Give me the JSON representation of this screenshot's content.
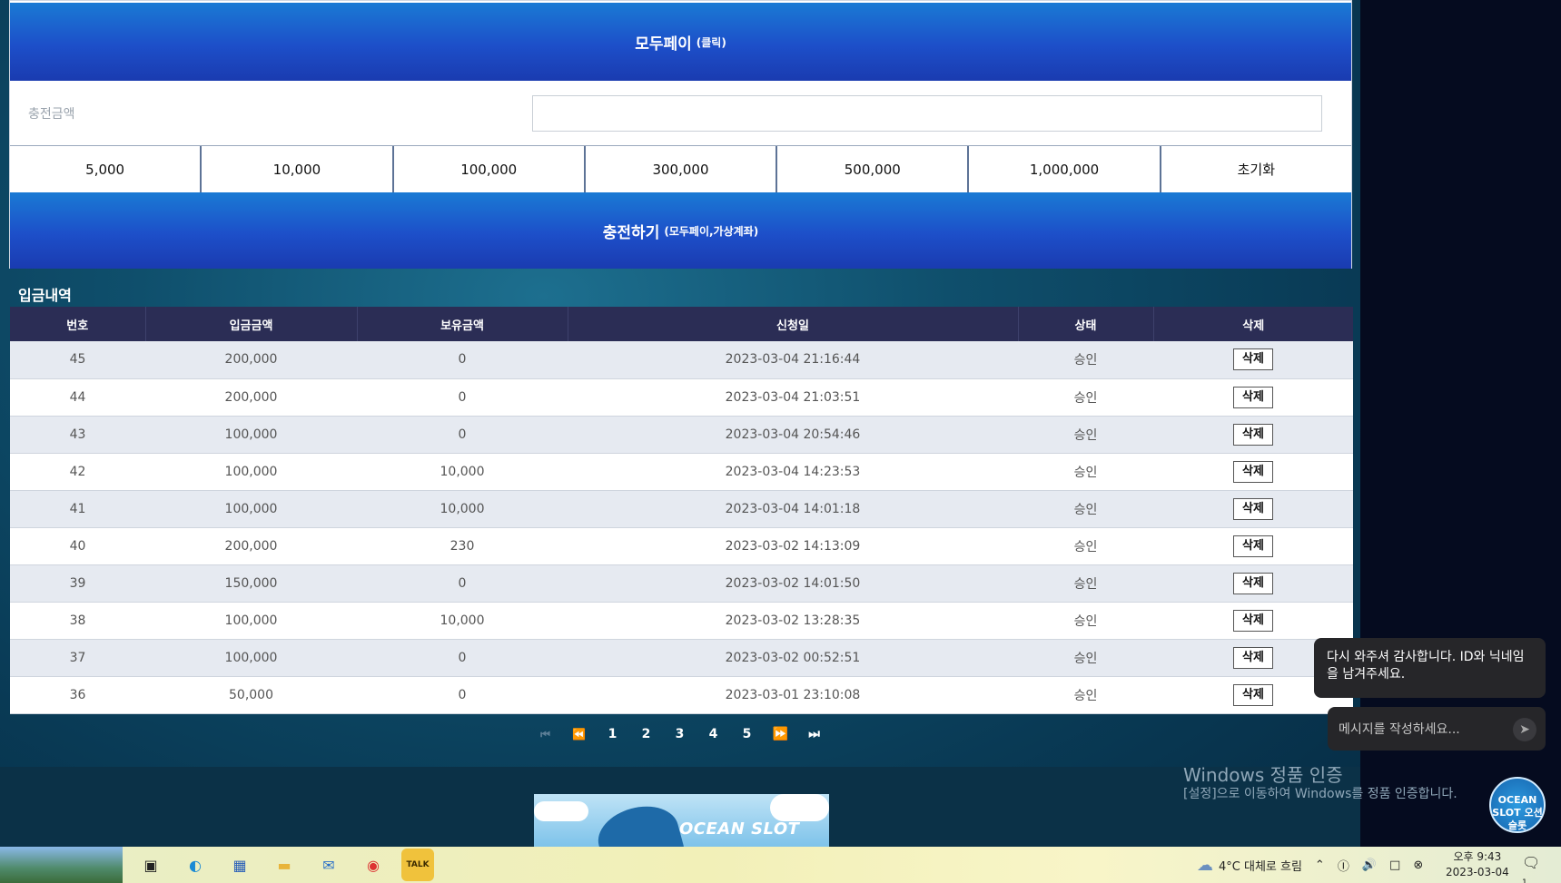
{
  "payment": {
    "title": "모두페이",
    "title_note": "(클릭)",
    "amount_label": "충전금액",
    "amount_value": "",
    "quick_amounts": [
      "5,000",
      "10,000",
      "100,000",
      "300,000",
      "500,000",
      "1,000,000",
      "초기화"
    ],
    "submit_label": "충전하기",
    "submit_note": "(모두페이,가상계좌)"
  },
  "history": {
    "title": "입금내역",
    "columns": [
      "번호",
      "입금금액",
      "보유금액",
      "신청일",
      "상태",
      "삭제"
    ],
    "rows": [
      [
        "45",
        "200,000",
        "0",
        "2023-03-04 21:16:44",
        "승인",
        "삭제"
      ],
      [
        "44",
        "200,000",
        "0",
        "2023-03-04 21:03:51",
        "승인",
        "삭제"
      ],
      [
        "43",
        "100,000",
        "0",
        "2023-03-04 20:54:46",
        "승인",
        "삭제"
      ],
      [
        "42",
        "100,000",
        "10,000",
        "2023-03-04 14:23:53",
        "승인",
        "삭제"
      ],
      [
        "41",
        "100,000",
        "10,000",
        "2023-03-04 14:01:18",
        "승인",
        "삭제"
      ],
      [
        "40",
        "200,000",
        "230",
        "2023-03-02 14:13:09",
        "승인",
        "삭제"
      ],
      [
        "39",
        "150,000",
        "0",
        "2023-03-02 14:01:50",
        "승인",
        "삭제"
      ],
      [
        "38",
        "100,000",
        "10,000",
        "2023-03-02 13:28:35",
        "승인",
        "삭제"
      ],
      [
        "37",
        "100,000",
        "0",
        "2023-03-02 00:52:51",
        "승인",
        "삭제"
      ],
      [
        "36",
        "50,000",
        "0",
        "2023-03-01 23:10:08",
        "승인",
        "삭제"
      ]
    ]
  },
  "pagination": {
    "first_icon": "first-page-icon",
    "prev_icon": "prev-page-icon",
    "pages": [
      "1",
      "2",
      "3",
      "4",
      "5"
    ],
    "next_icon": "next-page-icon",
    "last_icon": "last-page-icon"
  },
  "banner": {
    "text": "OCEAN SLOT"
  },
  "windows_watermark": {
    "title": "Windows 정품 인증",
    "subtitle": "[설정]으로 이동하여 Windows를 정품 인증합니다."
  },
  "chat": {
    "message": "다시 와주셔 감사합니다. ID와 닉네임을 남겨주세요.",
    "input_placeholder": "메시지를 작성하세요...",
    "logo_text": "OCEAN SLOT 오션슬롯"
  },
  "taskbar": {
    "apps": [
      "task-view-icon",
      "edge-icon",
      "store-icon",
      "file-explorer-icon",
      "mail-icon",
      "chrome-icon",
      "kakaotalk-icon"
    ],
    "kakao_label": "TALK",
    "weather": "4°C  대체로 흐림",
    "clock_time": "오후 9:43",
    "clock_date": "2023-03-04",
    "notification_count": "1"
  },
  "colors": {
    "header_blue": "#1d4fc9",
    "table_header": "#2b2d55",
    "row_alt": "#e6eaf1"
  }
}
